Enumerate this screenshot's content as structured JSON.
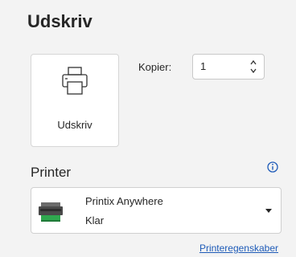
{
  "section": {
    "title": "Udskriv"
  },
  "print_button": {
    "label": "Udskriv",
    "icon": "printer-icon"
  },
  "copies": {
    "label": "Kopier:",
    "value": "1",
    "icon": "spinner-arrows-icon"
  },
  "printer": {
    "heading": "Printer",
    "info_icon": "info-icon",
    "selected_name": "Printix Anywhere",
    "selected_status": "Klar",
    "device_icon": "printer-device-icon",
    "dropdown_icon": "chevron-down-icon",
    "properties_link": "Printeregenskaber"
  },
  "colors": {
    "background": "#f3f3f3",
    "accent_blue": "#1e5bb8",
    "status_green": "#2fa84f"
  }
}
